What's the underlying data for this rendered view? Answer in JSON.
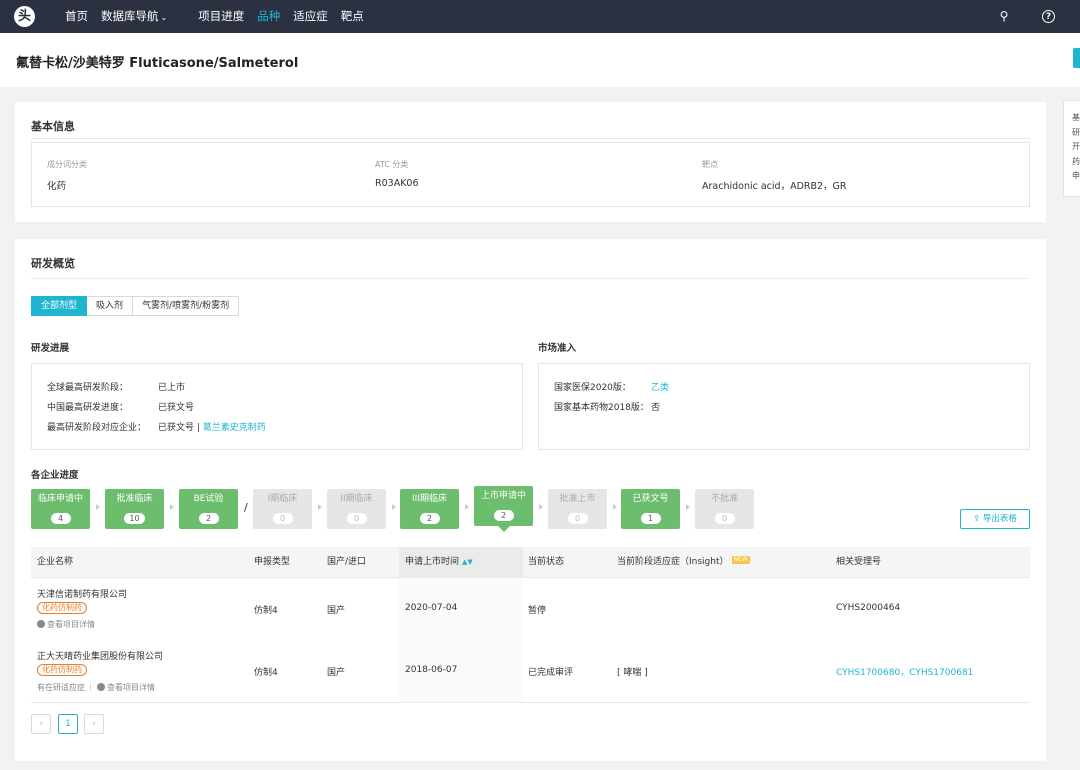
{
  "nav": {
    "logo_glyph": "头",
    "items": [
      "首页",
      "数据库导航",
      "项目进度",
      "品种",
      "适应症",
      "靶点"
    ],
    "caret": "⌄",
    "search_icon": "search-icon",
    "help_icon": "help-icon",
    "search_glyph": "⚲",
    "help_glyph": "?"
  },
  "title": "氟替卡松/沙美特罗 Fluticasone/Salmeterol",
  "right_nav": [
    "基",
    "研",
    "开",
    "药",
    "申"
  ],
  "basic": {
    "heading": "基本信息",
    "fields": [
      {
        "label": "成分词分类",
        "value": "化药"
      },
      {
        "label": "ATC 分类",
        "value": "R03AK06"
      },
      {
        "label": "靶点",
        "value": "Arachidonic acid，ADRB2，GR"
      }
    ]
  },
  "dev": {
    "heading": "研发概览",
    "dose_tabs": [
      "全部剂型",
      "吸入剂",
      "气雾剂/喷雾剂/粉雾剂"
    ],
    "progress": {
      "heading": "研发进展",
      "rows": [
        {
          "key": "全球最高研发阶段：",
          "value": "已上市"
        },
        {
          "key": "中国最高研发进度：",
          "value": "已获文号"
        },
        {
          "key": "最高研发阶段对应企业：",
          "value": "已获文号 |",
          "link": "葛兰素史克制药"
        }
      ]
    },
    "market": {
      "heading": "市场准入",
      "rows": [
        {
          "key": "国家医保2020版：",
          "value": "乙类"
        },
        {
          "key": "国家基本药物2018版：",
          "value": "否"
        }
      ]
    },
    "stages_heading": "各企业进度",
    "stages": [
      {
        "name": "临床申请中",
        "count": "4",
        "state": "green"
      },
      {
        "name": "批准临床",
        "count": "10",
        "state": "green"
      },
      {
        "name": "BE试验",
        "count": "2",
        "state": "green"
      },
      {
        "name": "I期临床",
        "count": "0",
        "state": "grey"
      },
      {
        "name": "II期临床",
        "count": "0",
        "state": "grey"
      },
      {
        "name": "III期临床",
        "count": "2",
        "state": "green"
      },
      {
        "name": "上市申请中",
        "count": "2",
        "state": "green-current"
      },
      {
        "name": "批准上市",
        "count": "0",
        "state": "grey"
      },
      {
        "name": "已获文号",
        "count": "1",
        "state": "green"
      },
      {
        "name": "不批准",
        "count": "0",
        "state": "grey"
      }
    ],
    "slash": "/",
    "export_label": "导出表格",
    "export_glyph": "⇪",
    "table": {
      "headers": [
        "企业名称",
        "申报类型",
        "国产/进口",
        "申请上市时间",
        "当前状态",
        "当前阶段适应症（Insight）",
        "相关受理号"
      ],
      "sort_glyph": "▲▼",
      "new_badge": "NEW",
      "rows": [
        {
          "company": "天津信诺制药有限公司",
          "tag": "化药仿制药",
          "links": [
            "查看项目详情"
          ],
          "type": "仿制4",
          "origin": "国产",
          "date": "2020-07-04",
          "status": "暂停",
          "indication": "",
          "accept": [
            "CYHS2000464"
          ]
        },
        {
          "company": "正大天晴药业集团股份有限公司",
          "tag": "化药仿制药",
          "links": [
            "有在研适应症",
            "查看项目详情"
          ],
          "type": "仿制4",
          "origin": "国产",
          "date": "2018-06-07",
          "status": "已完成审评",
          "indication": "[ 哮喘 ]",
          "accept": [
            "CYHS1700680",
            "，",
            "CYHS1700681"
          ]
        }
      ]
    },
    "pager": {
      "prev": "‹",
      "page": "1",
      "next": "›"
    }
  },
  "colors": {
    "accent": "#1fb5d1",
    "stage_green": "#6dbd6e",
    "tag_orange": "#e87e2c",
    "topbar": "#2c3142"
  }
}
